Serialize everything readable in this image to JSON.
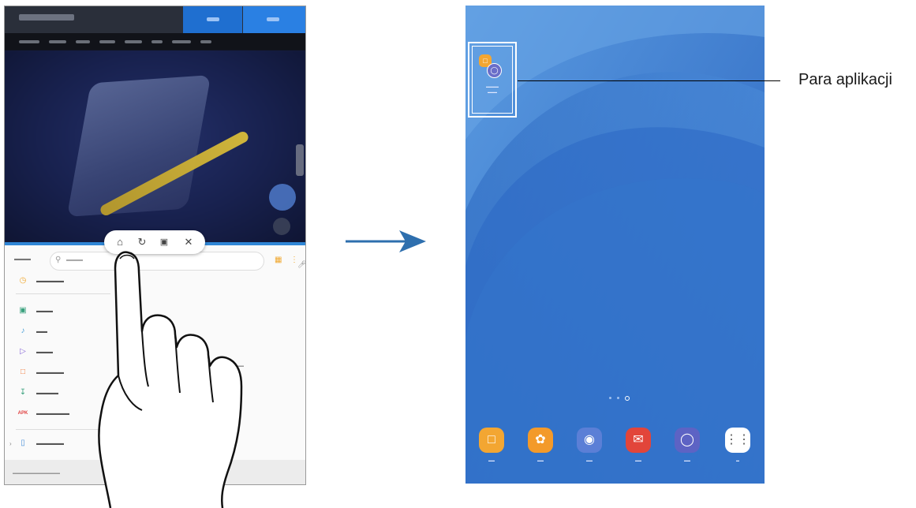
{
  "callout": {
    "label": "Para aplikacji"
  },
  "nav_popup": {
    "home_icon": "home-icon",
    "rotate_icon": "rotate-icon",
    "window_icon": "window-icon",
    "close_icon": "close-icon"
  },
  "dock": [
    {
      "icon": "folder-icon",
      "color": "#f3a632"
    },
    {
      "icon": "flower-icon",
      "color": "#f39a2a"
    },
    {
      "icon": "camera-icon",
      "color": "#5b7fd6"
    },
    {
      "icon": "mail-icon",
      "color": "#e2453a"
    },
    {
      "icon": "planet-icon",
      "color": "#5d63c4"
    },
    {
      "icon": "apps-grid-icon",
      "color": "#ffffff"
    }
  ],
  "file_categories": [
    {
      "icon": "clock-icon",
      "color": "#f0a830"
    },
    {
      "icon": "image-icon",
      "color": "#3aa17e"
    },
    {
      "icon": "music-icon",
      "color": "#4aa0d8"
    },
    {
      "icon": "video-icon",
      "color": "#8a6ad8"
    },
    {
      "icon": "document-icon",
      "color": "#f07a3a"
    },
    {
      "icon": "download-icon",
      "color": "#3aa17e"
    },
    {
      "icon": "apk-icon",
      "color": "#e04040"
    },
    {
      "icon": "phone-storage-icon",
      "color": "#4a90d8"
    }
  ],
  "colors": {
    "accent_blue": "#2f86d6",
    "wallpaper_blue": "#2f6fc7",
    "arrow_blue": "#2e6fae"
  }
}
